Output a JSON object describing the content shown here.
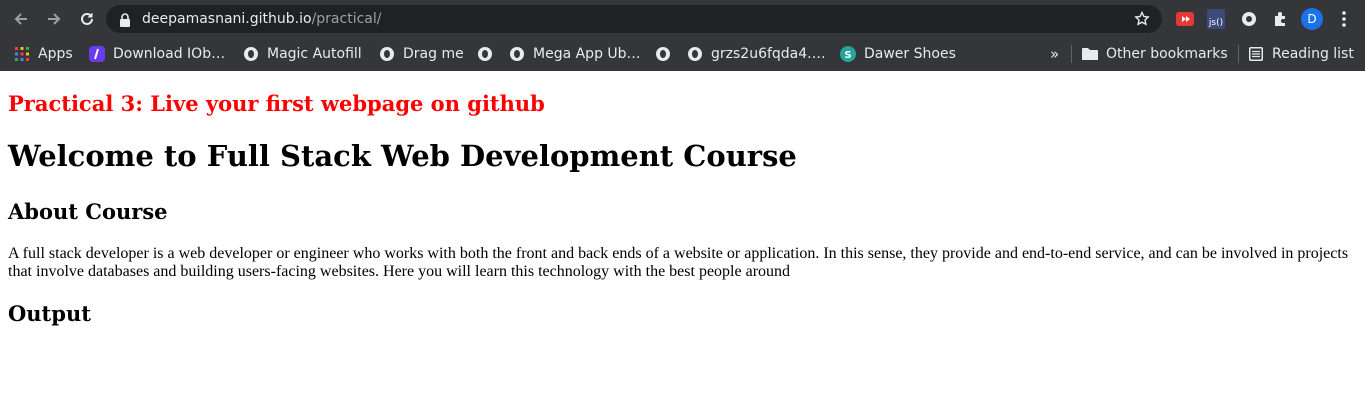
{
  "browser": {
    "url_host": "deepamasnani.github.io",
    "url_path": "/practical/",
    "profile_initial": "D",
    "colors": {
      "chrome_bg": "#35363a",
      "omnibox_bg": "#202124",
      "text": "#e8eaed",
      "muted": "#9aa0a6",
      "avatar": "#1a73e8"
    },
    "icons": [
      "back-icon",
      "forward-icon",
      "reload-icon",
      "lock-icon",
      "star-icon",
      "extension-red-icon",
      "extension-js-icon",
      "extension-circle-icon",
      "puzzle-icon",
      "kebab-menu-icon"
    ]
  },
  "bookmarks": {
    "items": [
      {
        "label": "Apps",
        "icon": "apps-grid-icon"
      },
      {
        "label": "Download IOb…",
        "icon": "download-iob-icon"
      },
      {
        "label": "Magic Autofill",
        "icon": "globe-icon"
      },
      {
        "label": "Drag me",
        "icon": "globe-icon"
      },
      {
        "label": "",
        "icon": "globe-icon"
      },
      {
        "label": "Mega App Ub…",
        "icon": "globe-icon"
      },
      {
        "label": "",
        "icon": "globe-icon"
      },
      {
        "label": "grzs2u6fqda4.…",
        "icon": "globe-icon"
      },
      {
        "label": "Dawer Shoes",
        "icon": "shop-icon"
      }
    ],
    "overflow": "»",
    "other": "Other bookmarks",
    "reading_list": "Reading list"
  },
  "page": {
    "practical_heading": "Practical 3: Live your first webpage on github",
    "title": "Welcome to Full Stack Web Development Course",
    "about_heading": "About Course",
    "about_text": "A full stack developer is a web developer or engineer who works with both the front and back ends of a website or application. In this sense, they provide and end-to-end service, and can be involved in projects that involve databases and building users-facing websites. Here you will learn this technology with the best people around",
    "output_heading": "Output",
    "accent_color": "#ff0000"
  }
}
